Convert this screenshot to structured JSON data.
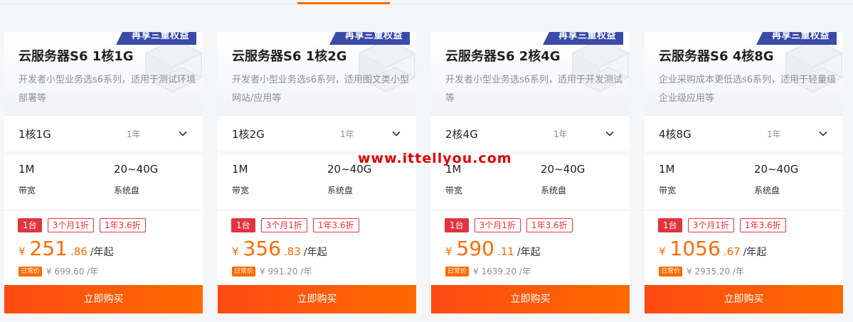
{
  "watermark": "www.ittellyou.com",
  "colors": {
    "accent": "#ff6a00",
    "badge": "#3a4aa8",
    "tag_red": "#e0343f"
  },
  "cards": [
    {
      "badge": "再享三重权益",
      "title": "云服务器S6 1核1G",
      "desc": "开发者小型业务选s6系列，适用于测试环境部署等",
      "spec": "1核1G",
      "term": "1年",
      "bandwidth_value": "1M",
      "bandwidth_label": "带宽",
      "disk_value": "20~40G",
      "disk_label": "系统盘",
      "tags": [
        "1台",
        "3个月1折",
        "1年3.6折"
      ],
      "currency": "¥",
      "price_int": "251",
      "price_dec": ".86",
      "price_unit": "/年起",
      "daily_badge": "日常价",
      "daily_price": "¥ 699.60 /年",
      "buy_label": "立即购买"
    },
    {
      "badge": "再享三重权益",
      "title": "云服务器S6 1核2G",
      "desc": "开发者小型业务选s6系列，适用图文类小型网站/应用等",
      "spec": "1核2G",
      "term": "1年",
      "bandwidth_value": "1M",
      "bandwidth_label": "带宽",
      "disk_value": "20~40G",
      "disk_label": "系统盘",
      "tags": [
        "1台",
        "3个月1折",
        "1年3.6折"
      ],
      "currency": "¥",
      "price_int": "356",
      "price_dec": ".83",
      "price_unit": "/年起",
      "daily_badge": "日常价",
      "daily_price": "¥ 991.20 /年",
      "buy_label": "立即购买"
    },
    {
      "badge": "再享三重权益",
      "title": "云服务器S6 2核4G",
      "desc": "开发者小型业务选s6系列，适用于开发测试等",
      "spec": "2核4G",
      "term": "1年",
      "bandwidth_value": "1M",
      "bandwidth_label": "带宽",
      "disk_value": "20~40G",
      "disk_label": "系统盘",
      "tags": [
        "1台",
        "3个月1折",
        "1年3.6折"
      ],
      "currency": "¥",
      "price_int": "590",
      "price_dec": ".11",
      "price_unit": "/年起",
      "daily_badge": "日常价",
      "daily_price": "¥ 1639.20 /年",
      "buy_label": "立即购买"
    },
    {
      "badge": "再享三重权益",
      "title": "云服务器S6 4核8G",
      "desc": "企业采购成本更低选s6系列，适用于轻量级企业级应用等",
      "spec": "4核8G",
      "term": "1年",
      "bandwidth_value": "1M",
      "bandwidth_label": "带宽",
      "disk_value": "20~40G",
      "disk_label": "系统盘",
      "tags": [
        "1台",
        "3个月1折",
        "1年3.6折"
      ],
      "currency": "¥",
      "price_int": "1056",
      "price_dec": ".67",
      "price_unit": "/年起",
      "daily_badge": "日常价",
      "daily_price": "¥ 2935.20 /年",
      "buy_label": "立即购买"
    }
  ]
}
